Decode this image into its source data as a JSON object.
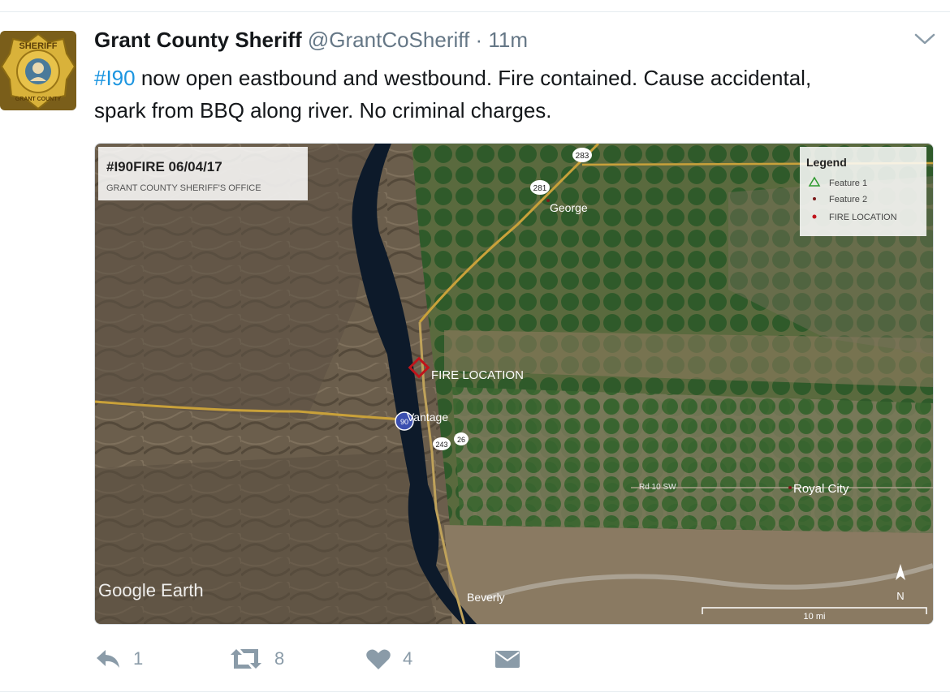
{
  "tweet": {
    "author_name": "Grant County Sheriff",
    "handle": "@GrantCoSheriff",
    "separator": "·",
    "time": "11m",
    "text_hashtag": "#I90",
    "text_line1_rest": " now open eastbound and westbound. Fire contained. Cause accidental,",
    "text_line2": "spark from BBQ along river. No criminal charges."
  },
  "avatar": {
    "badge_top": "SHERIFF",
    "badge_bottom": "GRANT COUNTY"
  },
  "map": {
    "title": "#I90FIRE 06/04/17",
    "subtitle": "GRANT COUNTY SHERIFF'S OFFICE",
    "legend_title": "Legend",
    "legend_items": [
      "Feature 1",
      "Feature 2",
      "FIRE LOCATION"
    ],
    "labels": {
      "george": "George",
      "fire": "FIRE LOCATION",
      "vantage": "Vantage",
      "royal_city": "Royal City",
      "beverly": "Beverly",
      "road": "Rd 10 SW",
      "shield_283": "283",
      "shield_281": "281",
      "shield_90": "90",
      "shield_243": "243",
      "shield_26": "26"
    },
    "watermark": "Google Earth",
    "scale": "10 mi",
    "north": "N"
  },
  "actions": {
    "reply_count": "1",
    "retweet_count": "8",
    "like_count": "4"
  },
  "colors": {
    "hashtag": "#1b95e0",
    "action_icon": "#8a9ba8",
    "fire_marker": "#c0141b"
  }
}
